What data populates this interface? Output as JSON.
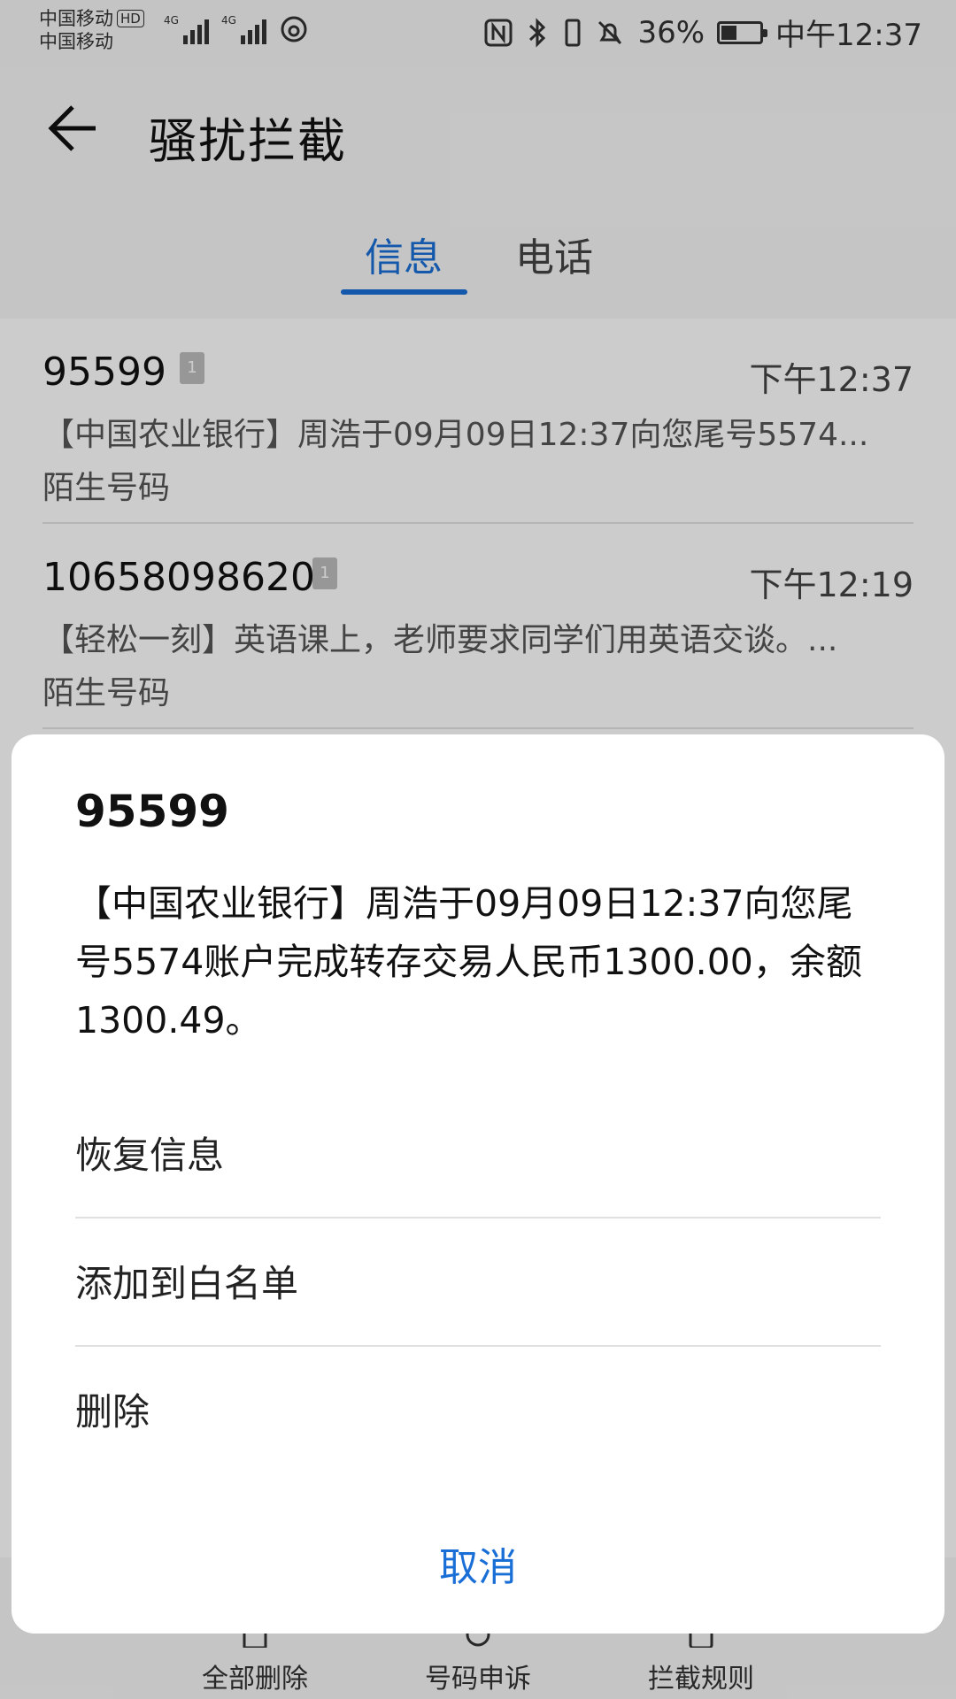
{
  "status_bar": {
    "carrier_1": "中国移动",
    "carrier_2": "中国移动",
    "hd_label": "HD",
    "network_1": "4G",
    "network_2": "4G",
    "battery_percent": "36%",
    "time": "中午12:37",
    "battery_level": 0.36
  },
  "header": {
    "title": "骚扰拦截",
    "back_icon": "back-arrow-icon"
  },
  "tabs": [
    {
      "label": "信息",
      "active": true
    },
    {
      "label": "电话",
      "active": false
    }
  ],
  "messages": [
    {
      "sender": "95599",
      "sim": "1",
      "time": "下午12:37",
      "preview": "【中国农业银行】周浩于09月09日12:37向您尾号5574...",
      "tag": "陌生号码"
    },
    {
      "sender": "10658098620",
      "sim": "1",
      "time": "下午12:19",
      "preview": "【轻松一刻】英语课上，老师要求同学们用英语交谈。...",
      "tag": "陌生号码"
    }
  ],
  "toolbar": {
    "delete_all": "全部删除",
    "number_appeal": "号码申诉",
    "block_rules": "拦截规则"
  },
  "dialog": {
    "title": "95599",
    "body": "【中国农业银行】周浩于09月09日12:37向您尾号5574账户完成转存交易人民币1300.00，余额1300.49。",
    "actions": [
      "恢复信息",
      "添加到白名单",
      "删除"
    ],
    "cancel": "取消"
  },
  "colors": {
    "accent": "#1a6fd6",
    "background": "#f7f7f7",
    "dialog": "#ffffff"
  }
}
